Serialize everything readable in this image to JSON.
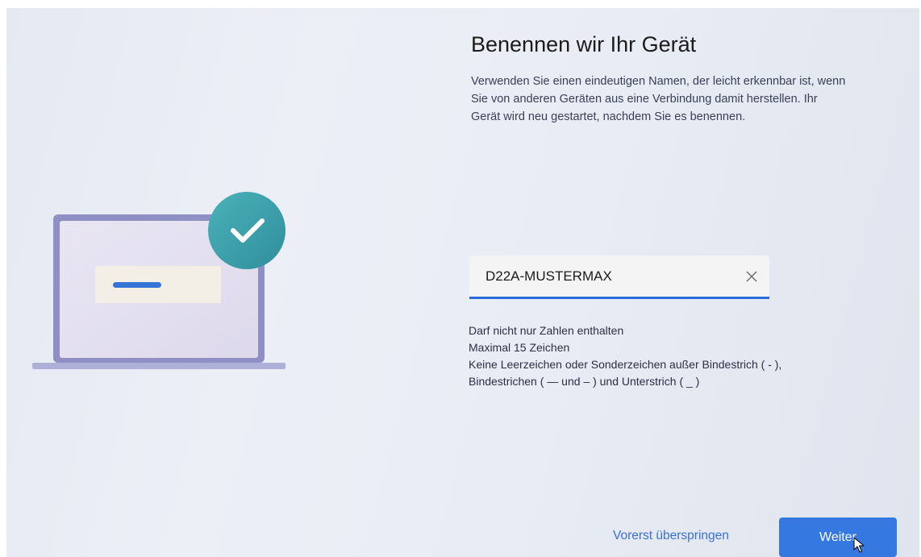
{
  "page": {
    "title": "Benennen wir Ihr Gerät",
    "description_lines": [
      "Verwenden Sie einen eindeutigen Namen, der leicht erkennbar ist, wenn",
      "Sie von anderen Geräten aus eine Verbindung damit herstellen. Ihr",
      "Gerät wird neu gestartet, nachdem Sie es benennen."
    ]
  },
  "name_field": {
    "value": "D22A-MUSTERMAX",
    "clear_icon": "close-icon"
  },
  "rules": [
    "Darf nicht nur Zahlen enthalten",
    "Maximal 15 Zeichen",
    "Keine Leerzeichen oder Sonderzeichen außer Bindestrich ( - ),",
    "Bindestrichen ( — und – ) und Unterstrich ( _ )"
  ],
  "actions": {
    "skip_label": "Vorerst überspringen",
    "next_label": "Weiter"
  },
  "icons": {
    "illustration": "laptop-checkmark-illustration",
    "check": "checkmark-icon",
    "cursor": "mouse-pointer-icon"
  },
  "colors": {
    "accent": "#3579e0",
    "field_underline": "#2a6bd9",
    "check_badge": "#3aa3ad",
    "laptop_frame": "#8f8fc6"
  }
}
